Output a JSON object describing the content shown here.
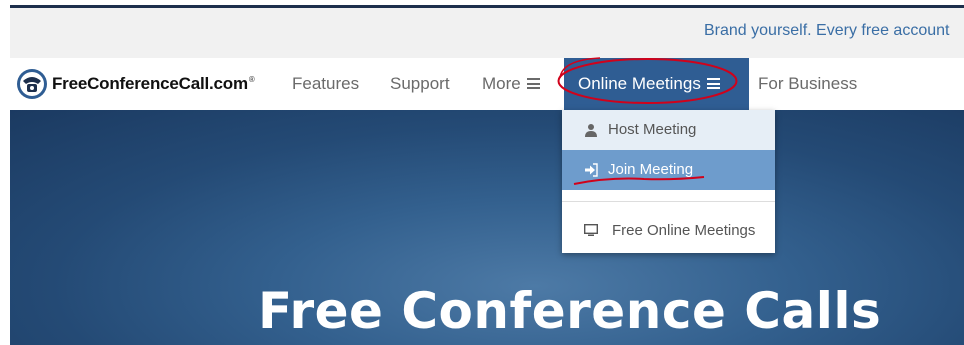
{
  "banner": {
    "text": "Brand yourself. Every free account"
  },
  "logo": {
    "text": "FreeConferenceCall.com",
    "reg": "®"
  },
  "nav": {
    "features": "Features",
    "support": "Support",
    "more": "More",
    "online_meetings": "Online Meetings",
    "for_business": "For Business"
  },
  "dropdown": {
    "host": "Host Meeting",
    "join": "Join Meeting",
    "free": "Free Online Meetings"
  },
  "hero": {
    "title": "Free Conference Calls"
  },
  "icons": {
    "logo": "phone-logo-icon",
    "menu": "hamburger-icon",
    "host": "user-icon",
    "join": "sign-in-icon",
    "free": "monitor-icon"
  },
  "colors": {
    "brand_dark": "#1d2f4c",
    "active_nav": "#2f5d93",
    "dropdown_hover": "#6e9ccc",
    "banner_text": "#3a6ea5",
    "annotation": "#d0021b"
  }
}
